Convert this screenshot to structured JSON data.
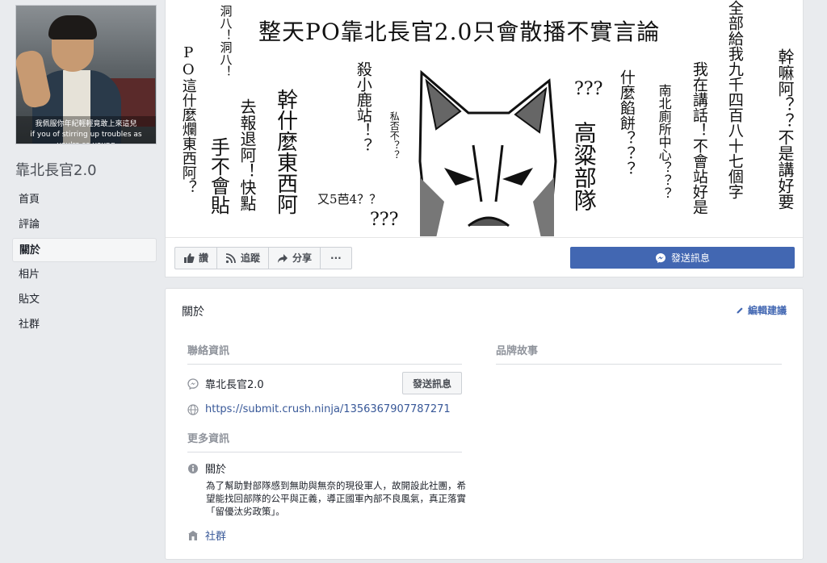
{
  "sidebar": {
    "profile_caption": "我佩服你年紀輕輕竟敢上來這兒\nif you of stirring up troubles as you're so young",
    "page_name": "靠北長官2.0",
    "nav": [
      {
        "label": "首頁",
        "active": false
      },
      {
        "label": "評論",
        "active": false
      },
      {
        "label": "關於",
        "active": true
      },
      {
        "label": "相片",
        "active": false
      },
      {
        "label": "貼文",
        "active": false
      },
      {
        "label": "社群",
        "active": false
      }
    ]
  },
  "cover": {
    "title": "整天PO靠北長官2.0只會散播不實言論",
    "texts": {
      "t1": "PO這什麼爛東西阿？",
      "t2": "洞八！洞八！",
      "t3": "手不會貼",
      "t4": "去報退阿！快點",
      "t5": "幹什麼東西阿",
      "t6": "殺小鹿站！？",
      "t7": "私否不？？",
      "t8": "又5芭4？？",
      "t9": "???",
      "t10": "???",
      "t11": "高粱部隊",
      "t12": "什麼餡餅？？？",
      "t13": "南北廁所中心？？？",
      "t14": "我在講話！不會站好是",
      "t15": "全部給我九千四百八十七個字",
      "t16": "幹嘛阿？？不是講好要"
    }
  },
  "actions": {
    "like": "讚",
    "follow": "追蹤",
    "share": "分享",
    "more": "···",
    "send_message": "發送訊息"
  },
  "about": {
    "title": "關於",
    "edit": "編輯建議",
    "contact_header": "聯絡資訊",
    "messenger_name": "靠北長官2.0",
    "send_btn": "發送訊息",
    "website": "https://submit.crush.ninja/1356367907787271",
    "more_header": "更多資訊",
    "about_label": "關於",
    "about_text": "為了幫助對部隊感到無助與無奈的現役軍人，故開設此社團，希望能找回部隊的公平與正義，導正國軍內部不良風氣，真正落實「留優汰劣政策」。",
    "community_label": "社群",
    "brand_header": "品牌故事"
  }
}
